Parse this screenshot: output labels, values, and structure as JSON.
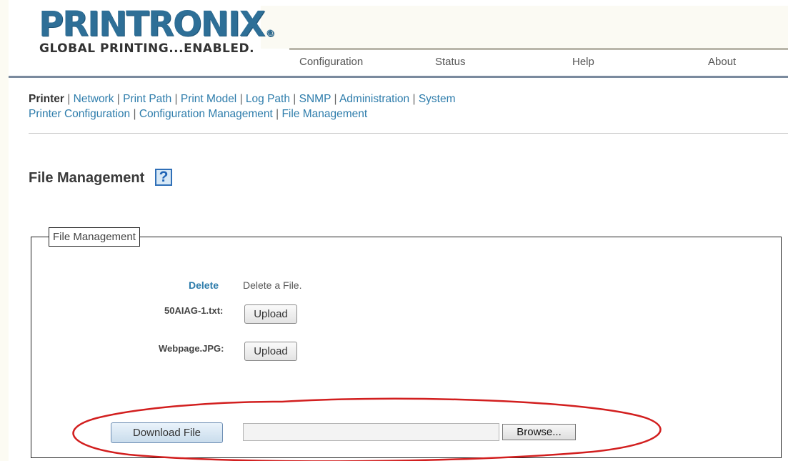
{
  "logo": {
    "brand": "PRINTRONIX",
    "registered_mark": "®",
    "tagline": "GLOBAL PRINTING...ENABLED."
  },
  "topnav": {
    "items": [
      "Configuration",
      "Status",
      "Help",
      "About"
    ]
  },
  "subnav": {
    "line1": {
      "current": "Printer",
      "separator": "|",
      "links": [
        "Network",
        "Print Path",
        "Print Model",
        "Log Path",
        "SNMP",
        "Administration",
        "System"
      ]
    },
    "line2": {
      "links": [
        "Printer Configuration",
        "Configuration Management",
        "File Management"
      ]
    }
  },
  "page": {
    "title": "File Management",
    "help_glyph": "?"
  },
  "panel": {
    "legend": "File Management",
    "delete_link": "Delete",
    "delete_desc": "Delete a File.",
    "files": [
      {
        "name": "50AIAG-1.txt:",
        "button": "Upload"
      },
      {
        "name": "Webpage.JPG:",
        "button": "Upload"
      }
    ],
    "download_button": "Download File",
    "file_input_value": "",
    "browse_button": "Browse..."
  },
  "colors": {
    "brand_blue": "#2e6f97",
    "link_blue": "#2d7cab",
    "annotation_red": "#d21f1f"
  }
}
